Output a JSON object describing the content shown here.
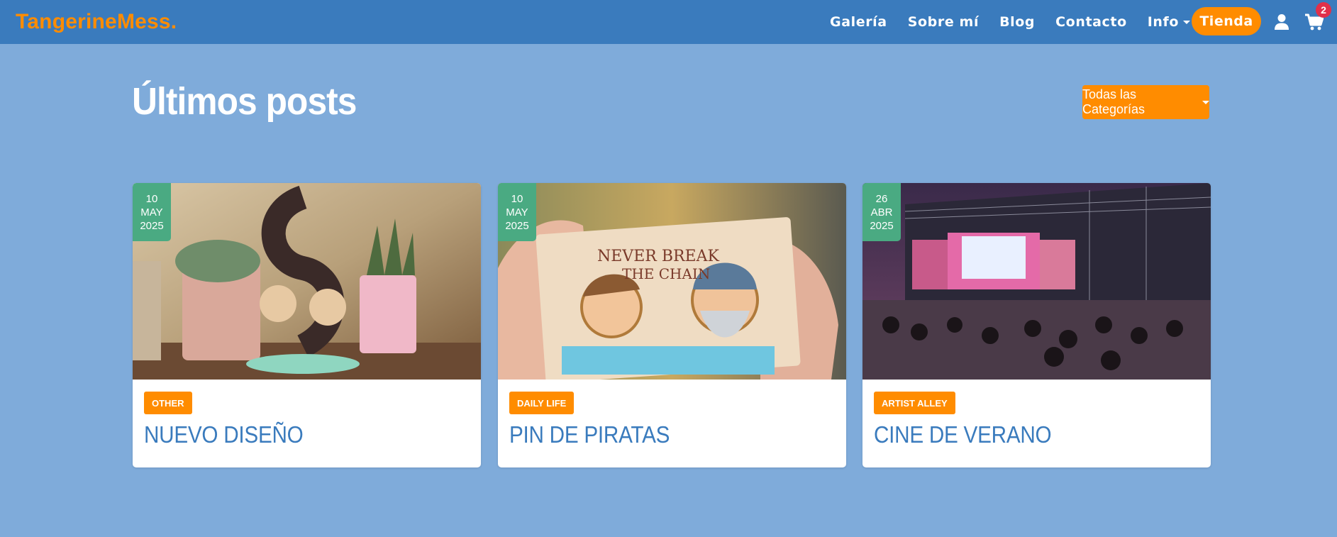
{
  "brand": "TangerineMess.",
  "nav": {
    "links": [
      "Galería",
      "Sobre mí",
      "Blog",
      "Contacto",
      "Info"
    ],
    "shop_label": "Tienda",
    "cart_count": "2"
  },
  "header": {
    "title": "Últimos posts",
    "category_dropdown": "Todas las Categorías"
  },
  "posts": [
    {
      "day": "10",
      "month": "MAY",
      "year": "2025",
      "category": "OTHER",
      "title": "NUEVO DISEÑO",
      "image": "acrylic-stand-with-succulents-photo"
    },
    {
      "day": "10",
      "month": "MAY",
      "year": "2025",
      "category": "DAILY LIFE",
      "title": "PIN DE PIRATAS",
      "image": "pirate-pins-in-hand-photo"
    },
    {
      "day": "26",
      "month": "ABR",
      "year": "2025",
      "category": "ARTIST ALLEY",
      "title": "CINE DE VERANO",
      "image": "outdoor-cinema-stage-photo"
    }
  ],
  "colors": {
    "background": "#7fabda",
    "navbar": "#3a7bbd",
    "accent": "#ff8c00",
    "date_badge": "#4aaa82",
    "link": "#3a7bbd",
    "cart_badge": "#e0304a"
  }
}
